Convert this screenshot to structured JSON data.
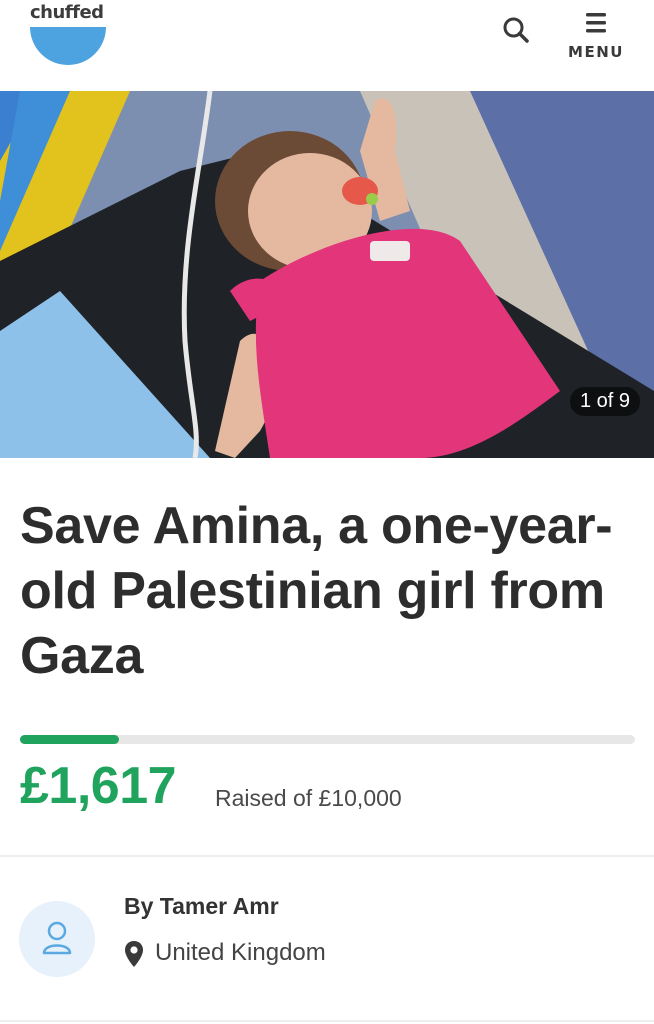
{
  "header": {
    "logo_text": "chuffed",
    "menu_label": "MENU",
    "brand_color": "#4da3e0"
  },
  "gallery": {
    "counter": "1 of 9",
    "current": 1,
    "total": 9
  },
  "campaign": {
    "title": "Save Amina, a one-year-old Palestinian girl from Gaza",
    "raised": "£1,617",
    "raised_suffix": "Raised of £10,000",
    "progress_fraction": 0.1617,
    "progress_color": "#20a35c"
  },
  "organiser": {
    "by": "By Tamer Amr",
    "location": "United Kingdom"
  },
  "icons": {
    "search": "search-icon",
    "menu": "hamburger-menu-icon",
    "avatar": "user-avatar-icon",
    "location": "location-pin-icon"
  }
}
